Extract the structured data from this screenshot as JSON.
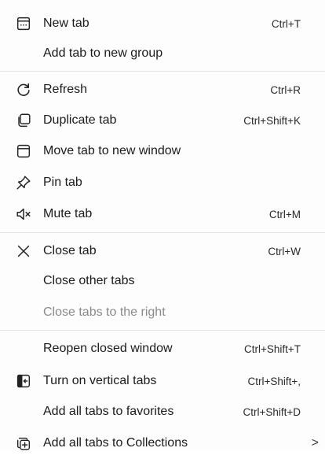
{
  "menu": {
    "items": [
      {
        "label": "New tab",
        "shortcut": "Ctrl+T",
        "icon": "new-tab-icon"
      },
      {
        "label": "Add tab to new group",
        "shortcut": "",
        "icon": ""
      },
      {
        "label": "Refresh",
        "shortcut": "Ctrl+R",
        "icon": "refresh-icon"
      },
      {
        "label": "Duplicate tab",
        "shortcut": "Ctrl+Shift+K",
        "icon": "duplicate-tab-icon"
      },
      {
        "label": "Move tab to new window",
        "shortcut": "",
        "icon": "window-icon"
      },
      {
        "label": "Pin tab",
        "shortcut": "",
        "icon": "pin-icon"
      },
      {
        "label": "Mute tab",
        "shortcut": "Ctrl+M",
        "icon": "speaker-mute-icon"
      },
      {
        "label": "Close tab",
        "shortcut": "Ctrl+W",
        "icon": "close-icon"
      },
      {
        "label": "Close other tabs",
        "shortcut": "",
        "icon": ""
      },
      {
        "label": "Close tabs to the right",
        "shortcut": "",
        "icon": "",
        "disabled": true
      },
      {
        "label": "Reopen closed window",
        "shortcut": "Ctrl+Shift+T",
        "icon": ""
      },
      {
        "label": "Turn on vertical tabs",
        "shortcut": "Ctrl+Shift+,",
        "icon": "vertical-tabs-icon"
      },
      {
        "label": "Add all tabs to favorites",
        "shortcut": "Ctrl+Shift+D",
        "icon": ""
      },
      {
        "label": "Add all tabs to Collections",
        "shortcut": "",
        "icon": "collections-icon",
        "submenu": ">"
      }
    ]
  }
}
